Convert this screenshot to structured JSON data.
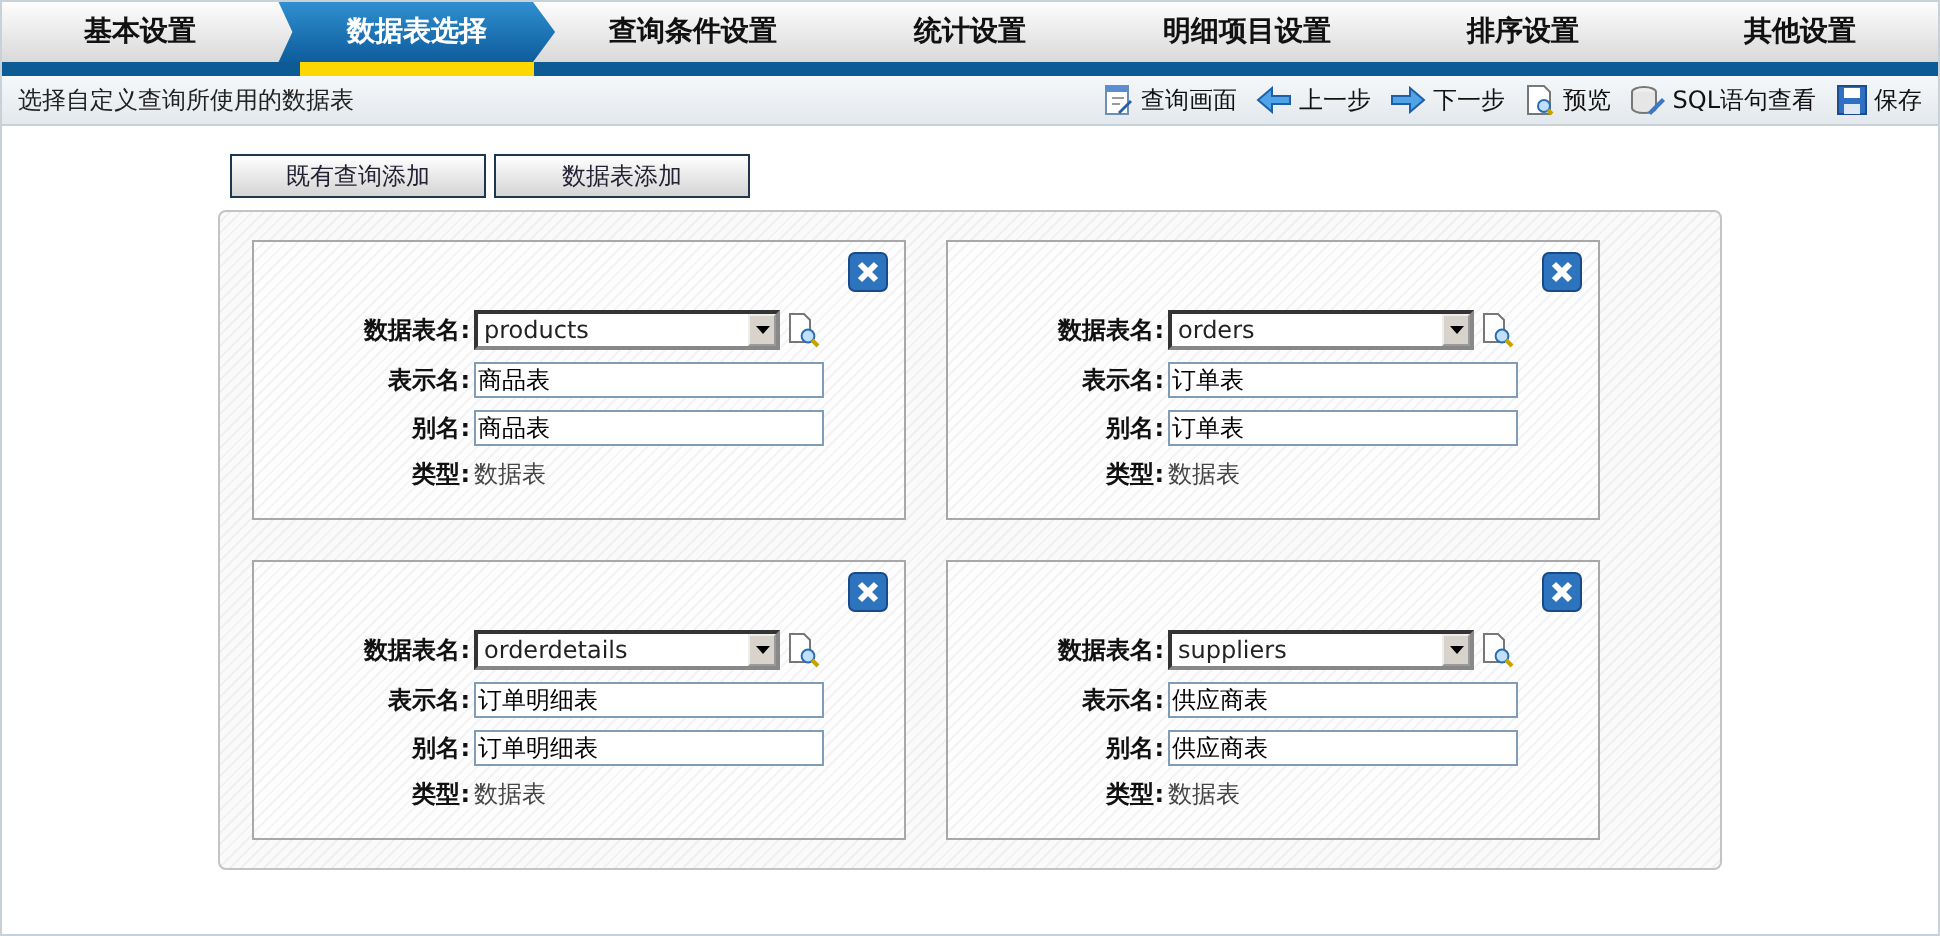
{
  "steps": [
    {
      "label": "基本设置",
      "selected": false
    },
    {
      "label": "数据表选择",
      "selected": true
    },
    {
      "label": "查询条件设置",
      "selected": false
    },
    {
      "label": "统计设置",
      "selected": false
    },
    {
      "label": "明细项目设置",
      "selected": false
    },
    {
      "label": "排序设置",
      "selected": false
    },
    {
      "label": "其他设置",
      "selected": false
    }
  ],
  "toolbar": {
    "description": "选择自定义查询所使用的数据表",
    "actions": [
      {
        "kind": "query",
        "label": "查询画面"
      },
      {
        "kind": "prev",
        "label": "上一步"
      },
      {
        "kind": "next",
        "label": "下一步"
      },
      {
        "kind": "preview",
        "label": "预览"
      },
      {
        "kind": "sql",
        "label": "SQL语句查看"
      },
      {
        "kind": "save",
        "label": "保存"
      }
    ]
  },
  "add_buttons": [
    "既有查询添加",
    "数据表添加"
  ],
  "cards": [
    {
      "labels": {
        "table_name": "数据表名:",
        "display_name": "表示名:",
        "alias": "别名:",
        "type": "类型:"
      },
      "table_name": "products",
      "display_name": "商品表",
      "alias": "商品表",
      "type": "数据表"
    },
    {
      "labels": {
        "table_name": "数据表名:",
        "display_name": "表示名:",
        "alias": "别名:",
        "type": "类型:"
      },
      "table_name": "orders",
      "display_name": "订单表",
      "alias": "订单表",
      "type": "数据表"
    },
    {
      "labels": {
        "table_name": "数据表名:",
        "display_name": "表示名:",
        "alias": "别名:",
        "type": "类型:"
      },
      "table_name": "orderdetails",
      "display_name": "订单明细表",
      "alias": "订单明细表",
      "type": "数据表"
    },
    {
      "labels": {
        "table_name": "数据表名:",
        "display_name": "表示名:",
        "alias": "别名:",
        "type": "类型:"
      },
      "table_name": "suppliers",
      "display_name": "供应商表",
      "alias": "供应商表",
      "type": "数据表"
    }
  ]
}
